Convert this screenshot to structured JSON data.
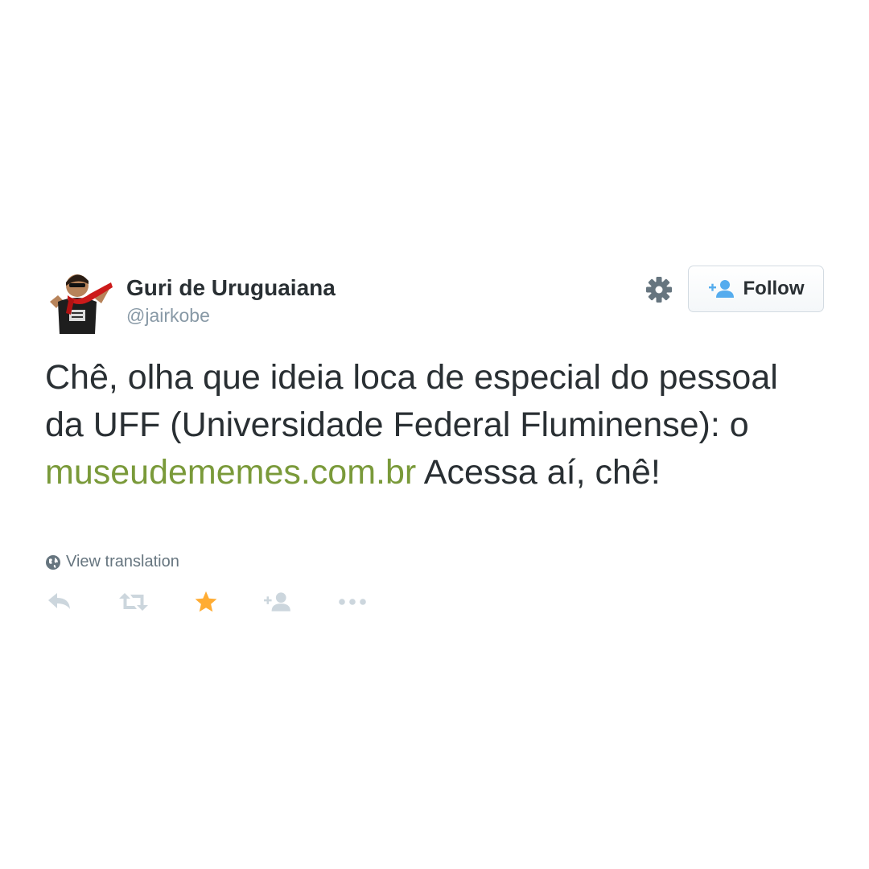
{
  "user": {
    "name": "Guri de Uruguaiana",
    "handle": "@jairkobe",
    "avatar_icon": "avatar-photo"
  },
  "header": {
    "settings_icon": "gear-icon",
    "follow_label": "Follow",
    "follow_icon": "follow-user-icon"
  },
  "tweet": {
    "text_part1": "Chê, olha que ideia loca de especial do pessoal da UFF (Universidade Federal Fluminense): o ",
    "link": "museudememes.com.br",
    "text_part2": " Acessa aí, chê!"
  },
  "translation": {
    "label": "View translation",
    "icon": "globe-icon"
  },
  "actions": [
    {
      "name": "reply",
      "icon": "reply-icon"
    },
    {
      "name": "retweet",
      "icon": "retweet-icon"
    },
    {
      "name": "favorite",
      "icon": "star-icon",
      "active": true
    },
    {
      "name": "follow",
      "icon": "add-user-icon"
    },
    {
      "name": "more",
      "icon": "more-icon"
    }
  ],
  "colors": {
    "text": "#292f33",
    "muted": "#8899a6",
    "link": "#7a9a3a",
    "favorite_active": "#ffac33",
    "action_icon": "#ccd6dd",
    "follow_icon": "#55acee"
  }
}
